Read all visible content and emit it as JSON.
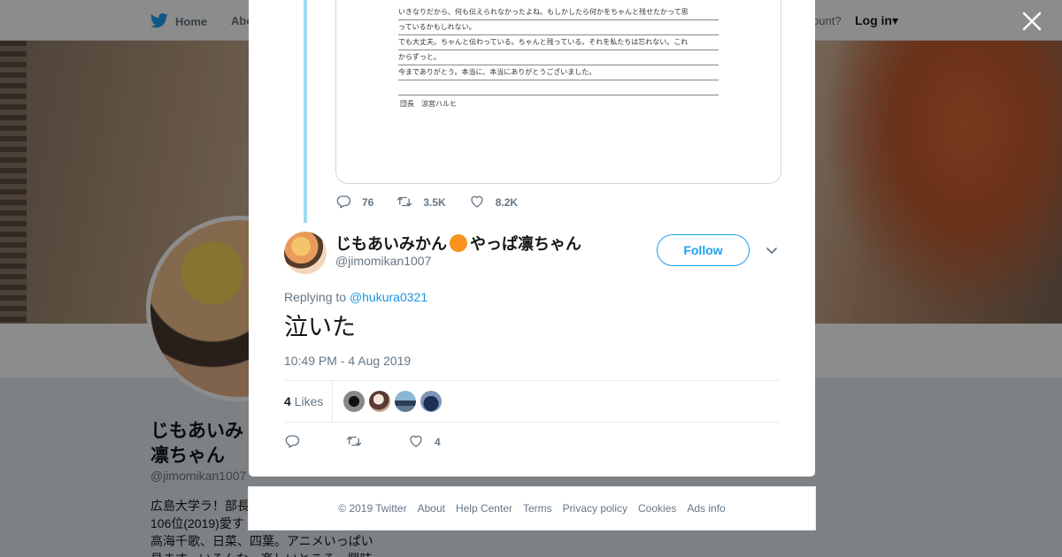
{
  "background": {
    "nav": {
      "home": "Home",
      "about": "Abo",
      "have_account": "ccount?",
      "login": "Log in"
    },
    "profile": {
      "name": "じもあいみ\n凛ちゃん",
      "handle": "@jimomikan1007",
      "bio": "広島大学ラ！部長\n106位(2019)愛す\n高海千歌、日菜、四葉。アニメいっぱい\n見ます。いろんな、楽しいところ、興味"
    }
  },
  "media": {
    "lines": [
      "いきなりだから、何も伝えられなかったよね。もしかしたら何かをちゃんと残せたかって思",
      "っているかもしれない。",
      "でも大丈夫。ちゃんと伝わっている。ちゃんと残っている。それを私たちは忘れない。これ",
      "からずっと。",
      "今までありがとう。本当に、本当にありがとうございました。",
      ""
    ],
    "signature": "団長　涼宮ハルヒ"
  },
  "parent_actions": {
    "replies": "76",
    "retweets": "3.5K",
    "likes": "8.2K"
  },
  "tweet": {
    "name_part1": "じもあいみかん",
    "name_part2": "やっぱ凛ちゃん",
    "handle": "@jimomikan1007",
    "follow_label": "Follow",
    "replying_prefix": "Replying to ",
    "replying_to": "@hukura0321",
    "text": "泣いた",
    "timestamp": "10:49 PM - 4 Aug 2019",
    "likes_number": "4",
    "likes_label": " Likes",
    "like_count": "4"
  },
  "footer": {
    "items": [
      "© 2019 Twitter",
      "About",
      "Help Center",
      "Terms",
      "Privacy policy",
      "Cookies",
      "Ads info"
    ]
  },
  "colors": {
    "accent": "#1da1f2",
    "link": "#1b95e0",
    "thread": "#a4d9f4",
    "muted": "#657786"
  },
  "icons": [
    "twitter-bird-icon",
    "close-icon",
    "reply-icon",
    "retweet-icon",
    "heart-icon",
    "chevron-down-icon"
  ]
}
